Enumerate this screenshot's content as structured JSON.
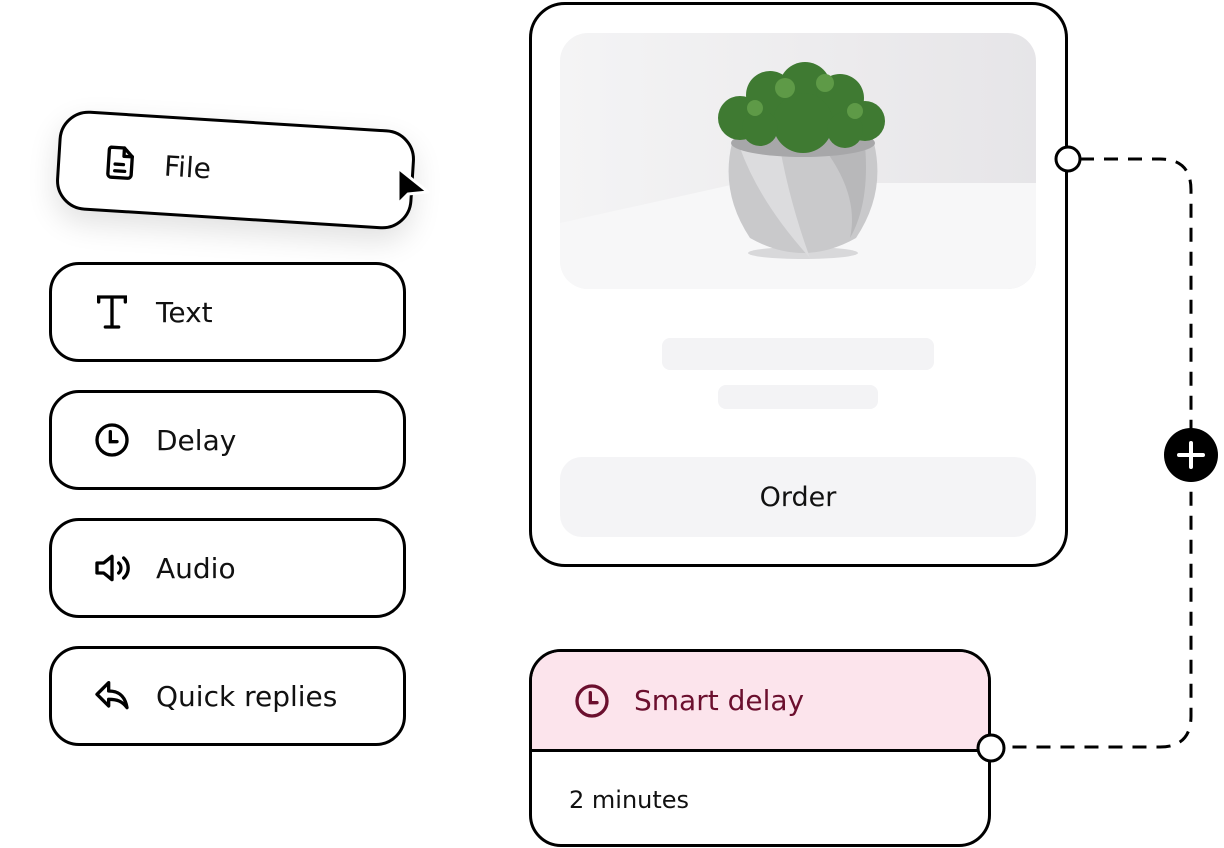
{
  "tools": [
    {
      "label": "File",
      "icon": "file-icon"
    },
    {
      "label": "Text",
      "icon": "text-icon"
    },
    {
      "label": "Delay",
      "icon": "clock-icon"
    },
    {
      "label": "Audio",
      "icon": "speaker-icon"
    },
    {
      "label": "Quick replies",
      "icon": "reply-icon"
    }
  ],
  "product_card": {
    "button_label": "Order",
    "image": "potted-moss-plant"
  },
  "smart_delay": {
    "title": "Smart delay",
    "value": "2 minutes",
    "header_color": "#fce4ec",
    "text_color": "#6b0f2e"
  }
}
